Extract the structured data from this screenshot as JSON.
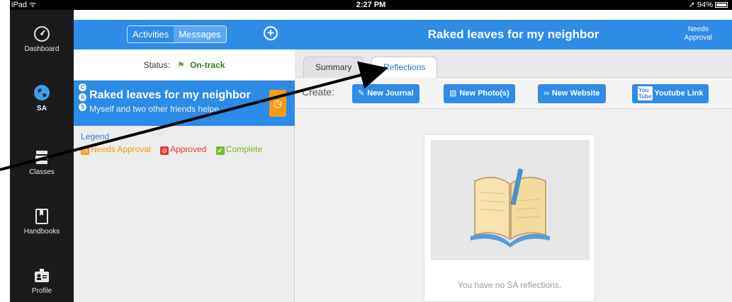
{
  "status_bar": {
    "device": "iPad",
    "time": "2:27 PM",
    "battery": "94%"
  },
  "sidebar": {
    "items": [
      {
        "label": "Dashboard",
        "icon": "dashboard-icon"
      },
      {
        "label": "SA",
        "icon": "globe-icon"
      },
      {
        "label": "Classes",
        "icon": "books-icon"
      },
      {
        "label": "Handbooks",
        "icon": "handbook-icon"
      },
      {
        "label": "Profile",
        "icon": "id-badge-icon"
      }
    ]
  },
  "list": {
    "segments": {
      "activities": "Activities",
      "messages": "Messages"
    },
    "status_label": "Status:",
    "status_value": "On-track",
    "selected_item": {
      "badges": [
        "C",
        "A",
        "S"
      ],
      "title": "Raked leaves for my neighbor",
      "subtitle": "Myself and two other friends helpe..."
    },
    "legend": {
      "title": "Legend",
      "items": [
        "Needs Approval",
        "Approved",
        "Complete"
      ]
    }
  },
  "detail": {
    "title": "Raked leaves for my neighbor",
    "needs_approval_line1": "Needs",
    "needs_approval_line2": "Approval",
    "tabs": {
      "summary": "Summary",
      "reflections": "Reflections"
    },
    "create_label": "Create:",
    "buttons": {
      "journal": "New Journal",
      "photo": "New Photo(s)",
      "website": "New Website",
      "youtube": "Youtube Link",
      "youtube_badge_top": "You",
      "youtube_badge_bottom": "Tube"
    },
    "empty_message": "You have no SA reflections."
  },
  "colors": {
    "accent": "#2f8ce6",
    "sidebar": "#1b1b1d",
    "needs_approval": "#f39c12",
    "approved": "#e53935",
    "complete": "#7cb82f"
  }
}
